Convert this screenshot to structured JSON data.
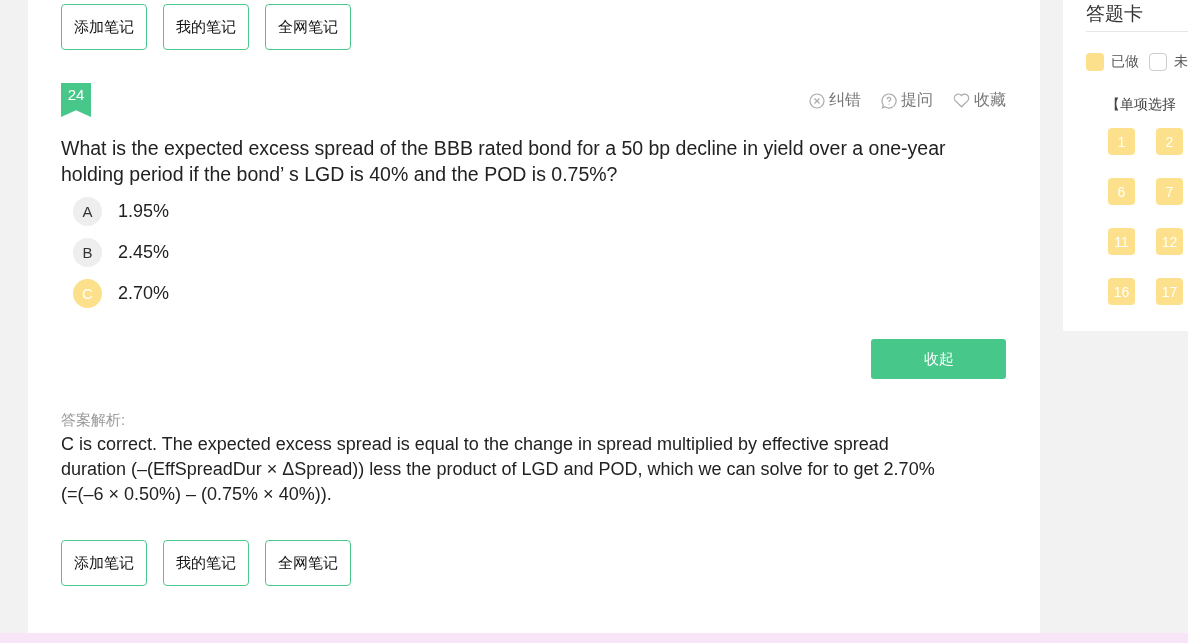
{
  "notes_top": [
    "添加笔记",
    "我的笔记",
    "全网笔记"
  ],
  "question": {
    "number": "24",
    "actions": [
      {
        "kind": "error",
        "label": "纠错"
      },
      {
        "kind": "ask",
        "label": "提问"
      },
      {
        "kind": "favorite",
        "label": "收藏"
      }
    ],
    "text": "What is the expected excess spread of the BBB rated bond for a 50 bp decline in yield over a one-year holding period if the bond’ s LGD is 40% and the POD is 0.75%?",
    "options": [
      {
        "letter": "A",
        "text": "1.95%",
        "selected": false
      },
      {
        "letter": "B",
        "text": "2.45%",
        "selected": false
      },
      {
        "letter": "C",
        "text": "2.70%",
        "selected": true
      }
    ],
    "collapse_button": "收起",
    "analysis_label": "答案解析:",
    "analysis": "C is correct. The expected excess spread is equal to the change in spread multiplied by effective spread duration (–(EffSpreadDur × ΔSpread)) less the product of LGD and POD, which we can solve for to get 2.70% (=(–6 × 0.50%) – (0.75% × 40%))."
  },
  "notes_bottom": [
    "添加笔记",
    "我的笔记",
    "全网笔记"
  ],
  "answer_card": {
    "title": "答题卡",
    "legend": [
      {
        "kind": "done",
        "label": "已做"
      },
      {
        "kind": "undone",
        "label": "未"
      }
    ],
    "section": "【单项选择",
    "items": [
      {
        "label": "1",
        "done": true
      },
      {
        "label": "2",
        "done": true
      },
      {
        "label": "6",
        "done": true
      },
      {
        "label": "7",
        "done": true
      },
      {
        "label": "11",
        "done": true
      },
      {
        "label": "12",
        "done": true
      },
      {
        "label": "16",
        "done": true
      },
      {
        "label": "17",
        "done": true
      }
    ]
  }
}
